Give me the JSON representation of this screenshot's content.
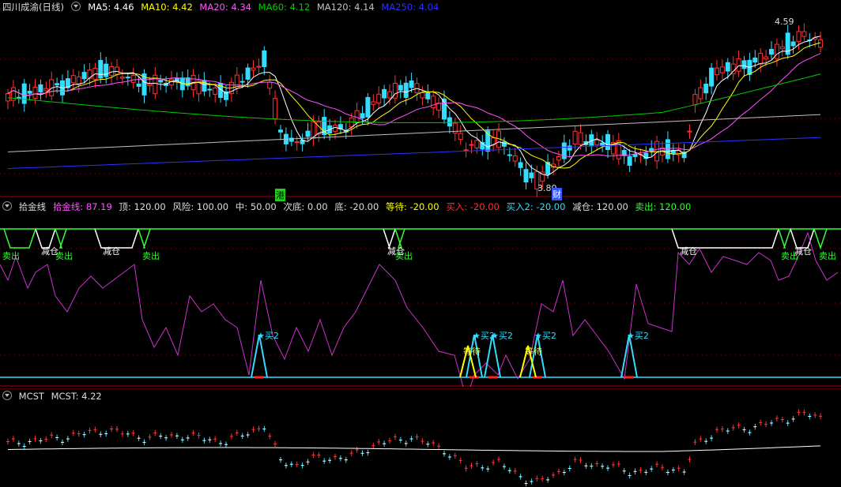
{
  "main": {
    "title": "四川成渝(日线)",
    "ma": [
      {
        "label": "MA5: 4.46",
        "color": "#ffffff"
      },
      {
        "label": "MA10: 4.42",
        "color": "#ffff00"
      },
      {
        "label": "MA20: 4.34",
        "color": "#ff55ff"
      },
      {
        "label": "MA60: 4.12",
        "color": "#00cc00"
      },
      {
        "label": "MA120: 4.14",
        "color": "#c0c0c0"
      },
      {
        "label": "MA250: 4.04",
        "color": "#3030ff"
      }
    ],
    "high_label": "4.59",
    "low_label": "3.80",
    "marker_gang": "港",
    "marker_cai": "财"
  },
  "ind1": {
    "name": "拾金线",
    "params": [
      {
        "label": "拾金线: 87.19",
        "color": "#ff55ff"
      },
      {
        "label": "顶: 120.00",
        "color": "#dddddd"
      },
      {
        "label": "风险: 100.00",
        "color": "#dddddd"
      },
      {
        "label": "中: 50.00",
        "color": "#dddddd"
      },
      {
        "label": "次底: 0.00",
        "color": "#dddddd"
      },
      {
        "label": "底: -20.00",
        "color": "#dddddd"
      },
      {
        "label": "等待: -20.00",
        "color": "#ffff00"
      },
      {
        "label": "买入: -20.00",
        "color": "#ff3030"
      },
      {
        "label": "买入2: -20.00",
        "color": "#33ddff"
      },
      {
        "label": "减仓: 120.00",
        "color": "#dddddd"
      },
      {
        "label": "卖出: 120.00",
        "color": "#33ff33"
      }
    ],
    "signals": {
      "sell": "卖出",
      "reduce": "减仓",
      "buy2": "买2",
      "wait": "等待"
    }
  },
  "ind2": {
    "name": "MCST",
    "value_label": "MCST: 4.22"
  },
  "colors": {
    "up": "#ff3333",
    "down": "#33ddff",
    "bg": "#000000",
    "grid": "#aa0000"
  }
}
